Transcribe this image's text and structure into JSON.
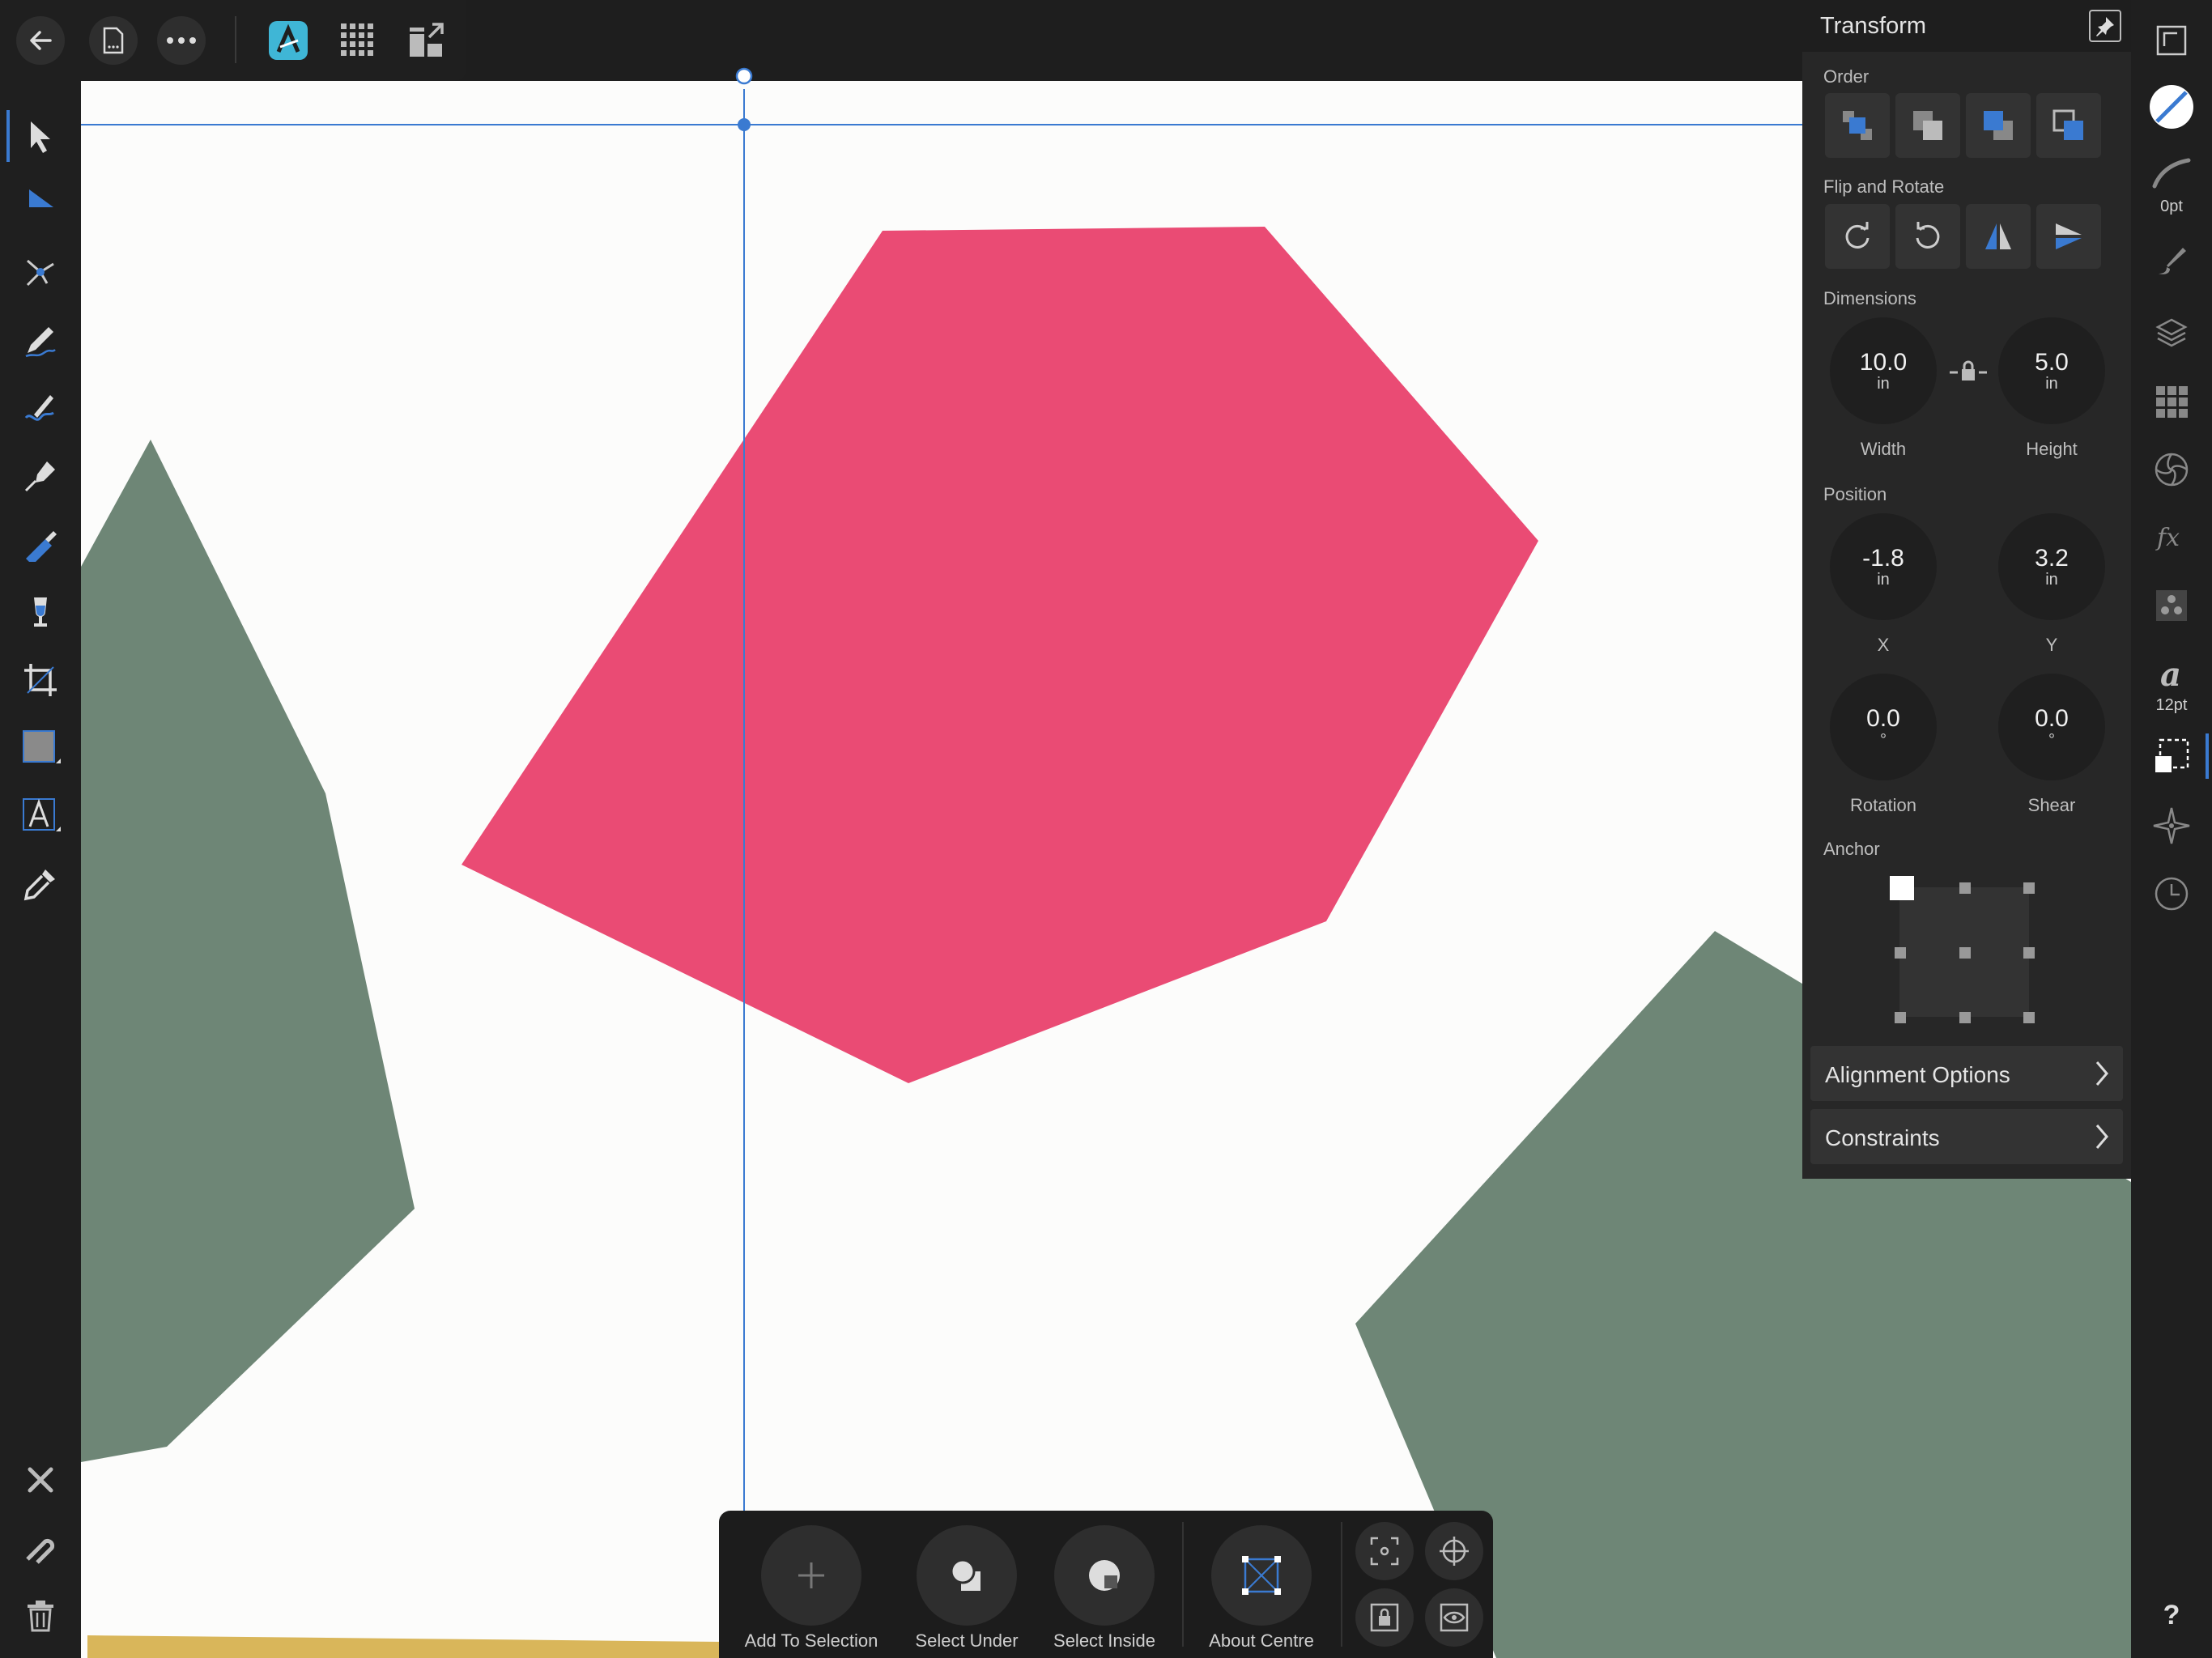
{
  "app": {
    "accent": "#3a7ad1",
    "brand": "#3fb6d6"
  },
  "colors": {
    "pink": "#ea4b74",
    "green": "#6e8676",
    "mustard": "#d9b65a",
    "canvas": "#fcfcfb"
  },
  "top_toolbar": {
    "items": [
      {
        "icon": "back-arrow-icon"
      },
      {
        "icon": "document-icon"
      },
      {
        "icon": "more-icon"
      },
      {
        "icon": "designer-persona-icon"
      },
      {
        "icon": "pixel-persona-icon"
      },
      {
        "icon": "export-persona-icon"
      }
    ]
  },
  "transform_panel": {
    "title": "Transform",
    "order_label": "Order",
    "flip_label": "Flip and Rotate",
    "dimensions_label": "Dimensions",
    "width": {
      "value": "10.0",
      "unit": "in",
      "label": "Width"
    },
    "height": {
      "value": "5.0",
      "unit": "in",
      "label": "Height"
    },
    "position_label": "Position",
    "x": {
      "value": "-1.8",
      "unit": "in",
      "label": "X"
    },
    "y": {
      "value": "3.2",
      "unit": "in",
      "label": "Y"
    },
    "rotation": {
      "value": "0.0",
      "unit": "°",
      "label": "Rotation"
    },
    "shear": {
      "value": "0.0",
      "unit": "°",
      "label": "Shear"
    },
    "anchor_label": "Anchor",
    "alignment_options": "Alignment Options",
    "constraints": "Constraints"
  },
  "right_strip": {
    "stroke_width": "0pt",
    "font_size": "12pt",
    "help": "?"
  },
  "context_bar": {
    "add_to_selection": "Add To Selection",
    "select_under": "Select Under",
    "select_inside": "Select Inside",
    "about_centre": "About Centre"
  }
}
